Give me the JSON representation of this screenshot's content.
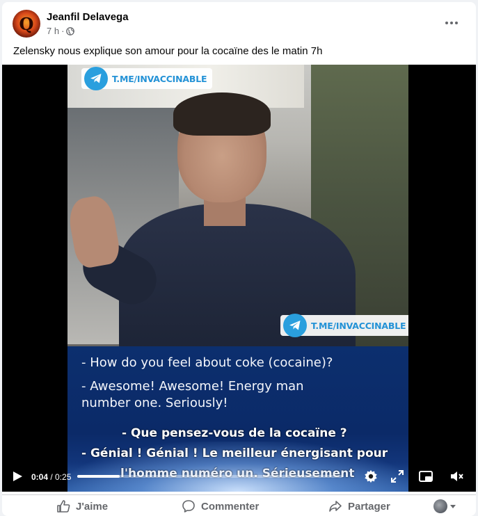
{
  "post": {
    "author": "Jeanfil Delavega",
    "avatar_letter": "Q",
    "timestamp": "7 h",
    "separator": "·",
    "audience_icon": "globe-icon",
    "more_icon": "more-options-icon",
    "caption": "Zelensky nous explique son amour pour la cocaïne des le matin 7h"
  },
  "video": {
    "watermark_top": "T.ME/INVACCINABLE",
    "watermark_bottom": "T.ME/INVACCINABLE",
    "subtitles_en": [
      "- How do you feel about coke (cocaine)?",
      "- Awesome! Awesome! Energy man",
      "number one. Seriously!"
    ],
    "subtitles_fr": [
      "- Que pensez-vous de la cocaïne ?",
      "- Génial ! Génial ! Le meilleur énergisant pour",
      "l'homme numéro un. Sérieusement"
    ],
    "controls": {
      "current_time": "0:04",
      "time_separator": " / ",
      "duration": "0:25",
      "progress_fraction": 0.16,
      "icons": [
        "play-icon",
        "settings-icon",
        "fullscreen-icon",
        "picture-in-picture-icon",
        "volume-muted-icon"
      ]
    }
  },
  "actions": {
    "like": "J'aime",
    "comment": "Commenter",
    "share": "Partager"
  },
  "colors": {
    "telegram_blue": "#2a9fde",
    "secondary_text": "#65676b",
    "subtitle_panel": "#0c2f6e"
  }
}
